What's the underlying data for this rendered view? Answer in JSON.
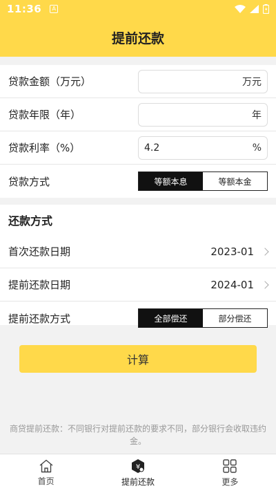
{
  "status": {
    "time": "11:36",
    "app_icon": "A"
  },
  "header": {
    "title": "提前还款"
  },
  "loan": {
    "amount_label": "贷款金额（万元）",
    "amount_value": "",
    "amount_unit": "万元",
    "years_label": "贷款年限（年）",
    "years_value": "",
    "years_unit": "年",
    "rate_label": "贷款利率（%）",
    "rate_value": "4.2",
    "rate_unit": "%",
    "method_label": "贷款方式",
    "method_options": [
      "等额本息",
      "等额本金"
    ],
    "method_selected": "等额本息"
  },
  "repay": {
    "section_title": "还款方式",
    "first_date_label": "首次还款日期",
    "first_date_value": "2023-01",
    "early_date_label": "提前还款日期",
    "early_date_value": "2024-01",
    "early_method_label": "提前还款方式",
    "early_method_options": [
      "全部偿还",
      "部分偿还"
    ],
    "early_method_selected": "全部偿还"
  },
  "calculate_label": "计算",
  "note": "商贷提前还款：不同银行对提前还款的要求不同，部分银行会收取违约金。",
  "tabs": [
    {
      "label": "首页",
      "icon": "home-icon"
    },
    {
      "label": "提前还款",
      "icon": "early-repay-icon"
    },
    {
      "label": "更多",
      "icon": "more-icon"
    }
  ],
  "colors": {
    "accent": "#ffd94a",
    "text": "#222222",
    "muted": "#999999"
  }
}
